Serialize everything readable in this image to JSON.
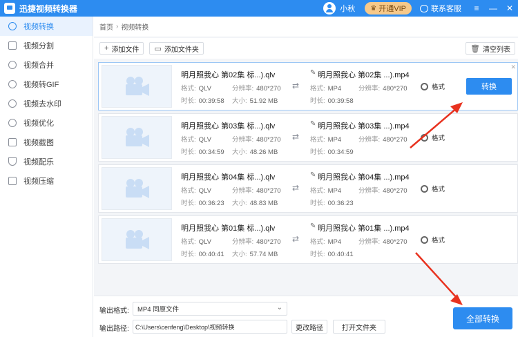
{
  "window": {
    "app_title": "迅捷视频转换器",
    "username": "小秋",
    "vip_label": "开通VIP",
    "support_label": "联系客服",
    "controls": [
      "≡",
      "—",
      "✕"
    ]
  },
  "sidebar": {
    "items": [
      {
        "label": "视频转换",
        "active": true
      },
      {
        "label": "视频分割"
      },
      {
        "label": "视频合并"
      },
      {
        "label": "视频转GIF"
      },
      {
        "label": "视频去水印"
      },
      {
        "label": "视频优化"
      },
      {
        "label": "视频截图"
      },
      {
        "label": "视频配乐"
      },
      {
        "label": "视频压缩"
      }
    ]
  },
  "breadcrumb": {
    "home": "首页",
    "sep": "›",
    "current": "视频转换"
  },
  "toolbar": {
    "add_file": "添加文件",
    "add_folder": "添加文件夹",
    "clear_list": "清空列表"
  },
  "labels": {
    "format": "格式:",
    "resolution": "分辨率:",
    "duration": "时长:",
    "size": "大小:",
    "format_button": "格式",
    "convert_button": "转换"
  },
  "files": [
    {
      "src_name": "明月照我心 第02集 标...).qlv",
      "src_format": "QLV",
      "src_resolution": "480*270",
      "src_duration": "00:39:58",
      "src_size": "51.92 MB",
      "dst_name": "明月照我心 第02集 ...).mp4",
      "dst_format": "MP4",
      "dst_resolution": "480*270",
      "dst_duration": "00:39:58"
    },
    {
      "src_name": "明月照我心 第03集 标...).qlv",
      "src_format": "QLV",
      "src_resolution": "480*270",
      "src_duration": "00:34:59",
      "src_size": "48.26 MB",
      "dst_name": "明月照我心 第03集 ...).mp4",
      "dst_format": "MP4",
      "dst_resolution": "480*270",
      "dst_duration": "00:34:59"
    },
    {
      "src_name": "明月照我心 第04集 标...).qlv",
      "src_format": "QLV",
      "src_resolution": "480*270",
      "src_duration": "00:36:23",
      "src_size": "48.83 MB",
      "dst_name": "明月照我心 第04集 ...).mp4",
      "dst_format": "MP4",
      "dst_resolution": "480*270",
      "dst_duration": "00:36:23"
    },
    {
      "src_name": "明月照我心 第01集 标...).qlv",
      "src_format": "QLV",
      "src_resolution": "480*270",
      "src_duration": "00:40:41",
      "src_size": "57.74 MB",
      "dst_name": "明月照我心 第01集 ...).mp4",
      "dst_format": "MP4",
      "dst_resolution": "480*270",
      "dst_duration": "00:40:41"
    }
  ],
  "output": {
    "format_label": "输出格式:",
    "format_value": "MP4   同原文件",
    "path_label": "输出路径:",
    "path_value": "C:\\Users\\cenfeng\\Desktop\\视频转换",
    "change_path": "更改路径",
    "open_folder": "打开文件夹",
    "convert_all": "全部转换"
  },
  "colors": {
    "accent": "#2d8cf0",
    "vip": "#f7c98a",
    "annotation": "#e8321f"
  }
}
